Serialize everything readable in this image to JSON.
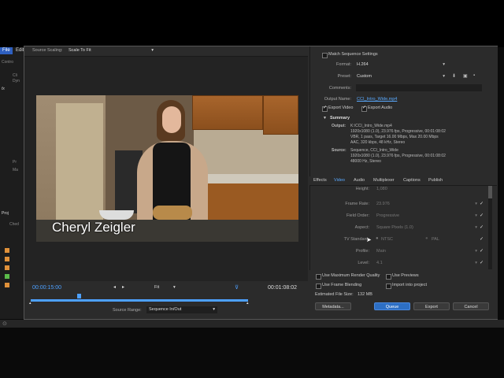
{
  "background_app": {
    "menu": [
      "File",
      "Edit"
    ],
    "panel_labels": [
      "Contro",
      "fx",
      "Cli",
      "Dyn",
      "Proj",
      "Ched"
    ],
    "side_labels": [
      "Pr",
      "Ma"
    ]
  },
  "source_panel": {
    "scaling_label": "Source Scaling:",
    "scaling_value": "Scale To Fit",
    "caption": "Cheryl Zeigler",
    "timecode_in": "00:00:15:00",
    "timecode_out": "00:01:08:02",
    "fit_value": "Fit",
    "source_range_label": "Source Range:",
    "source_range_value": "Sequence In/Out",
    "playhead_fraction": 0.22
  },
  "export": {
    "match_sequence": "Match Sequence Settings",
    "format_label": "Format:",
    "format_value": "H.264",
    "preset_label": "Preset:",
    "preset_value": "Custom",
    "comments_label": "Comments:",
    "output_name_label": "Output Name:",
    "output_name_value": "CCI_Intro_Wide.mp4",
    "export_video": "Export Video",
    "export_audio": "Export Audio",
    "summary_title": "Summary",
    "output_label": "Output:",
    "output_lines": [
      "K:\\CCI_Intro_Wide.mp4",
      "1920x1080 (1.0), 23.976 fps, Progressive, 00:01:08:02",
      "VBR, 1 pass, Target 16.00 Mbps, Max 20.00 Mbps",
      "AAC, 320 kbps, 48 kHz, Stereo"
    ],
    "source_label": "Source:",
    "source_lines": [
      "Sequence, CCI_Intro_Wide",
      "1920x1080 (1.0), 23.976 fps, Progressive, 00:01:08:02",
      "48000 Hz, Stereo"
    ]
  },
  "tabs": [
    "Effects",
    "Video",
    "Audio",
    "Multiplexer",
    "Captions",
    "Publish"
  ],
  "active_tab": "Video",
  "video_settings": {
    "height_label": "Height:",
    "height_value": "1,080",
    "frame_rate_label": "Frame Rate:",
    "frame_rate_value": "23.976",
    "field_order_label": "Field Order:",
    "field_order_value": "Progressive",
    "aspect_label": "Aspect:",
    "aspect_value": "Square Pixels (1.0)",
    "tv_standard_label": "TV Standard:",
    "tv_ntsc": "NTSC",
    "tv_pal": "PAL",
    "profile_label": "Profile:",
    "profile_value": "Main",
    "level_label": "Level:",
    "level_value": "4.1"
  },
  "options": {
    "max_render_quality": "Use Maximum Render Quality",
    "use_previews": "Use Previews",
    "frame_blending": "Use Frame Blending",
    "import_into_project": "Import into project",
    "file_size_label": "Estimated File Size:",
    "file_size_value": "132 MB"
  },
  "buttons": {
    "metadata": "Metadata...",
    "queue": "Queue",
    "export": "Export",
    "cancel": "Cancel"
  },
  "colors": {
    "accent": "#2d6fc4",
    "timecode_blue": "#4da0ff",
    "panel": "#2b2b2b"
  }
}
